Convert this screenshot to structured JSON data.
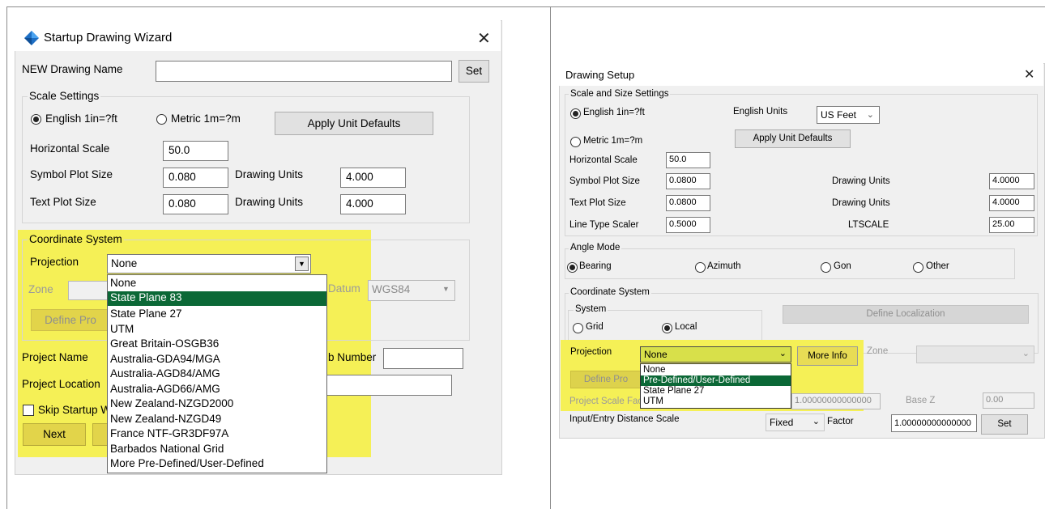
{
  "left": {
    "title": "Startup Drawing Wizard",
    "name_label": "NEW Drawing Name",
    "name_value": "",
    "set_button": "Set",
    "scale_group": "Scale Settings",
    "radio_english": "English 1in=?ft",
    "radio_metric": "Metric 1m=?m",
    "apply_button": "Apply Unit Defaults",
    "horizontal_scale_label": "Horizontal Scale",
    "horizontal_scale_value": "50.0",
    "symbol_plot_label": "Symbol Plot Size",
    "symbol_plot_value": "0.080",
    "drawing_units_label": "Drawing Units",
    "symbol_units_value": "4.000",
    "text_plot_label": "Text Plot Size",
    "text_plot_value": "0.080",
    "text_units_value": "4.000",
    "coord_group": "Coordinate System",
    "projection_label": "Projection",
    "projection_value": "None",
    "zone_label": "Zone",
    "datum_label": "Datum",
    "datum_value": "WGS84",
    "define_button": "Define Pro",
    "project_name_label": "Project Name",
    "job_number_label": "b Number",
    "project_location_label": "Project Location",
    "skip_label": "Skip Startup W",
    "next_button": "Next",
    "dropdown": [
      "None",
      "State Plane 83",
      "State Plane 27",
      "UTM",
      "Great Britain-OSGB36",
      "Australia-GDA94/MGA",
      "Australia-AGD84/AMG",
      "Australia-AGD66/AMG",
      "New Zealand-NZGD2000",
      "New Zealand-NZGD49",
      "France NTF-GR3DF97A",
      "Barbados National Grid",
      "More Pre-Defined/User-Defined"
    ],
    "dropdown_selected": "State Plane 83"
  },
  "right": {
    "title": "Drawing Setup",
    "scale_group": "Scale and Size Settings",
    "radio_english": "English 1in=?ft",
    "english_units_label": "English Units",
    "english_units_value": "US Feet",
    "radio_metric": "Metric 1m=?m",
    "apply_button": "Apply Unit Defaults",
    "horizontal_scale_label": "Horizontal Scale",
    "horizontal_scale_value": "50.0",
    "symbol_plot_label": "Symbol Plot Size",
    "symbol_plot_value": "0.0800",
    "drawing_units_label": "Drawing Units",
    "symbol_units_value": "4.0000",
    "text_plot_label": "Text Plot Size",
    "text_plot_value": "0.0800",
    "text_units_value": "4.0000",
    "line_type_label": "Line Type Scaler",
    "line_type_value": "0.5000",
    "ltscale_label": "LTSCALE",
    "ltscale_value": "25.00",
    "angle_group": "Angle Mode",
    "angle_bearing": "Bearing",
    "angle_azimuth": "Azimuth",
    "angle_gon": "Gon",
    "angle_other": "Other",
    "coord_group": "Coordinate System",
    "system_group": "System",
    "system_grid": "Grid",
    "system_local": "Local",
    "define_localization": "Define Localization",
    "projection_label": "Projection",
    "projection_value": "None",
    "more_info_button": "More Info",
    "zone_label": "Zone",
    "define_button": "Define Pro",
    "project_scale_label": "Project Scale Fac",
    "project_scale_value": "1.00000000000000",
    "base_z_label": "Base Z",
    "base_z_value": "0.00",
    "input_distance_label": "Input/Entry Distance Scale",
    "fixed_value": "Fixed",
    "factor_label": "Factor",
    "factor_value": "1.00000000000000",
    "set_button": "Set",
    "dropdown": [
      "None",
      "Pre-Defined/User-Defined",
      "State Plane 27",
      "UTM"
    ],
    "dropdown_selected": "Pre-Defined/User-Defined"
  },
  "colors": {
    "highlight": "#f5f056",
    "selection": "#0b6836",
    "dialog": "#f0f0f0",
    "logo": "#1e6fc4"
  }
}
